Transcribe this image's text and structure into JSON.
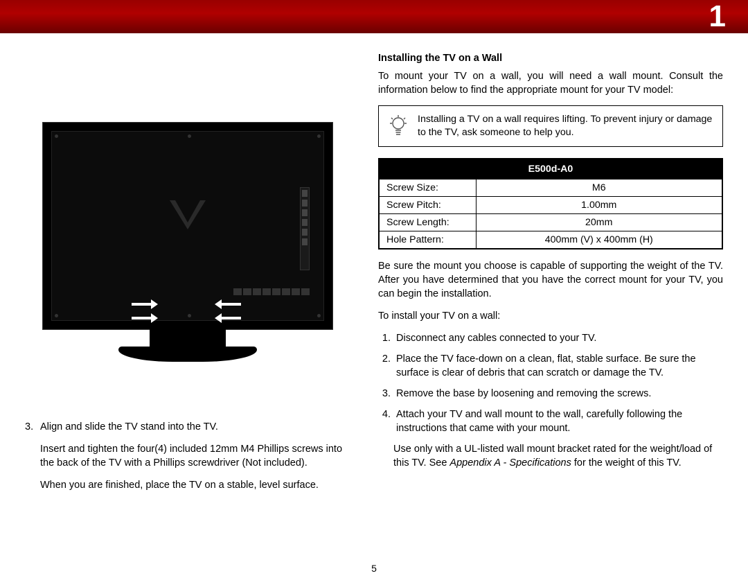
{
  "header": {
    "chapter_number": "1"
  },
  "page_number": "5",
  "left": {
    "step3_num": "3.",
    "step3_line": "Align and slide the TV stand into the TV.",
    "step3_p2": "Insert and tighten the four(4) included 12mm M4 Phillips screws into the back of the TV with a Phillips screwdriver (Not included).",
    "step3_p3": "When you are finished, place the TV on a stable, level surface."
  },
  "right": {
    "section_title": "Installing the TV on a Wall",
    "intro": "To mount your TV on a wall, you will need a wall mount. Consult the information below to find the appropriate mount for your TV model:",
    "tip": "Installing a TV on a wall requires lifting. To prevent injury or damage to the TV, ask someone to help you.",
    "table": {
      "header": "E500d-A0",
      "rows": [
        {
          "label": "Screw Size:",
          "value": "M6"
        },
        {
          "label": "Screw Pitch:",
          "value": "1.00mm"
        },
        {
          "label": "Screw Length:",
          "value": "20mm"
        },
        {
          "label": "Hole Pattern:",
          "value": "400mm (V) x 400mm (H)"
        }
      ]
    },
    "after_table": "Be sure the mount you choose is capable of supporting the weight of the TV. After you have determined that you have the correct mount for your TV, you can begin the installation.",
    "lead_in": "To install your TV on a wall:",
    "steps": [
      "Disconnect any cables connected to your TV.",
      "Place the TV face-down on a clean, flat, stable surface. Be sure the surface is clear of debris that can scratch or damage the TV.",
      "Remove the base by loosening and removing the screws.",
      "Attach your TV and wall mount to the wall, carefully following the instructions that came with your mount."
    ],
    "note_pre": "Use only with a UL-listed wall mount bracket rated for the weight/load of this TV. See ",
    "note_em": "Appendix A - Specifications",
    "note_post": " for the weight of this TV."
  }
}
